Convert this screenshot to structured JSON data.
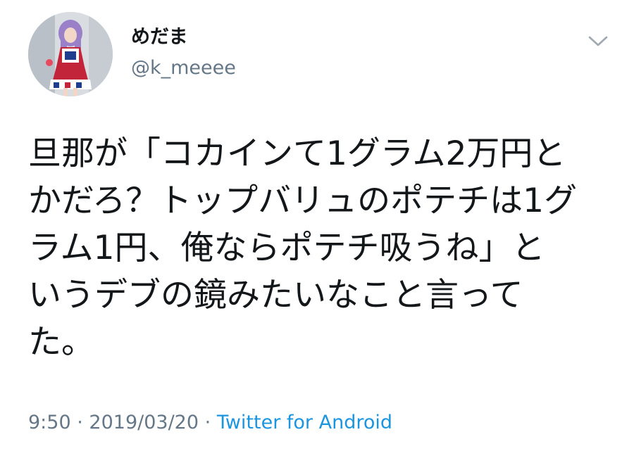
{
  "user": {
    "display_name": "めだま",
    "handle": "@k_meeee",
    "avatar_icon": "user-avatar"
  },
  "tweet": {
    "lines": [
      "旦那が「コカインて1グラム2万円と",
      "かだろ？トップバリュのポテチは1グ",
      "ラム1円、俺ならポテチ吸うね」と",
      "いうデブの鏡みたいなこと言って",
      "た。"
    ]
  },
  "meta": {
    "time": "9:50",
    "separator": "·",
    "date": "2019/03/20",
    "source": "Twitter for Android"
  },
  "icons": {
    "menu": "chevron-down-icon"
  },
  "colors": {
    "text": "#14171a",
    "secondary": "#657786",
    "link": "#1b95e0",
    "background": "#ffffff"
  }
}
